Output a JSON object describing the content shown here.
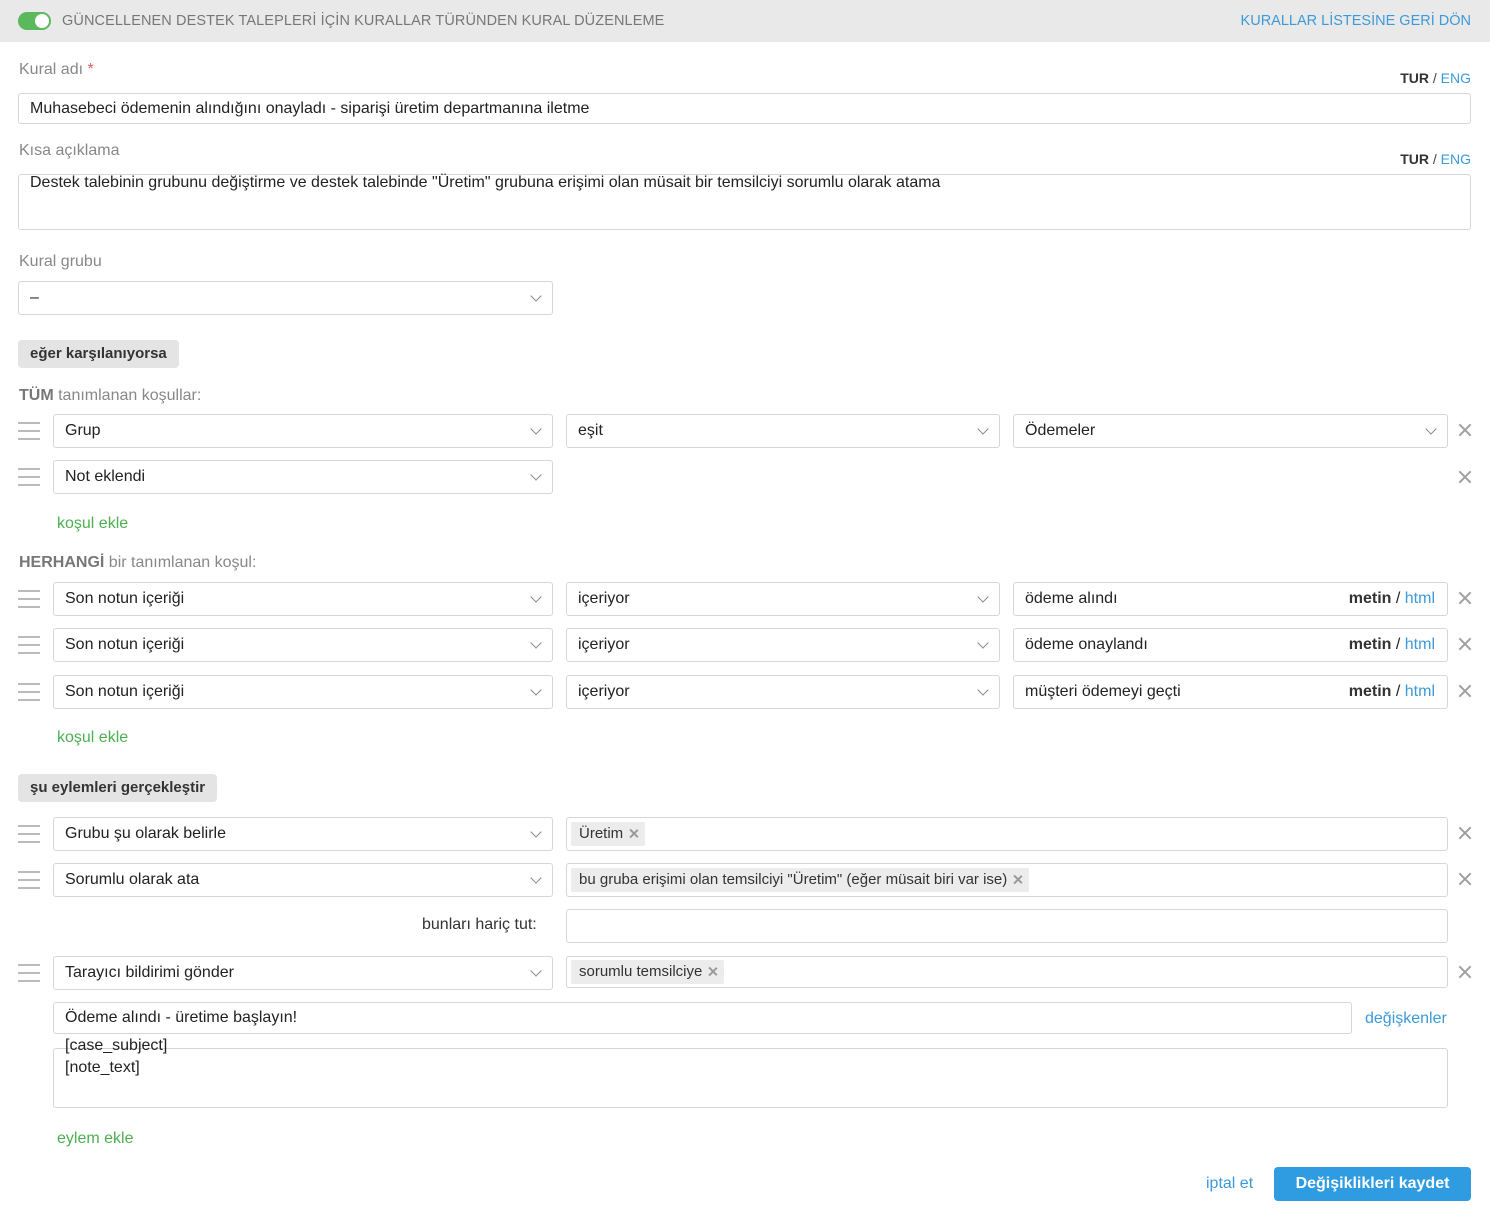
{
  "header": {
    "title": "GÜNCELLENEN DESTEK TALEPLERİ İÇİN KURALLAR TÜRÜNDEN KURAL DÜZENLEME",
    "back_link": "KURALLAR LİSTESİNE GERİ DÖN",
    "toggle_on": true
  },
  "language": {
    "current": "TUR",
    "separator": "/",
    "alternate": "ENG"
  },
  "rule_name": {
    "label": "Kural adı",
    "required_mark": "*",
    "value": "Muhasebeci ödemenin alındığını onayladı - siparişi üretim departmanına iletme"
  },
  "short_description": {
    "label": "Kısa açıklama",
    "value": "Destek talebinin grubunu değiştirme ve destek talebinde \"Üretim\" grubuna erişimi olan müsait bir temsilciyi sorumlu olarak atama"
  },
  "rule_group": {
    "label": "Kural grubu",
    "value": "–"
  },
  "conditions": {
    "section_label": "eğer karşılanıyorsa",
    "all": {
      "label_bold": "TÜM",
      "label_rest": " tanımlanan koşullar:",
      "rows": [
        {
          "field": "Grup",
          "operator": "eşit",
          "value": "Ödemeler"
        },
        {
          "field": "Not eklendi"
        }
      ],
      "add_label": "koşul ekle"
    },
    "any": {
      "label_bold": "HERHANGİ",
      "label_rest": " bir tanımlanan koşul:",
      "rows": [
        {
          "field": "Son notun içeriği",
          "operator": "içeriyor",
          "value": "ödeme alındı"
        },
        {
          "field": "Son notun içeriği",
          "operator": "içeriyor",
          "value": "ödeme onaylandı"
        },
        {
          "field": "Son notun içeriği",
          "operator": "içeriyor",
          "value": "müşteri ödemeyi geçti"
        }
      ],
      "add_label": "koşul ekle"
    },
    "format": {
      "current": "metin",
      "separator": "/",
      "alternate": "html"
    }
  },
  "actions": {
    "section_label": "şu eylemleri gerçekleştir",
    "rows": [
      {
        "action": "Grubu şu olarak belirle",
        "tags": [
          "Üretim"
        ]
      },
      {
        "action": "Sorumlu olarak ata",
        "tags": [
          "bu gruba erişimi olan temsilciyi \"Üretim\" (eğer müsait biri var ise)"
        ],
        "exclude_label": "bunları hariç tut:",
        "exclude_value": ""
      },
      {
        "action": "Tarayıcı bildirimi gönder",
        "tags": [
          "sorumlu temsilciye"
        ],
        "subject": "Ödeme alındı - üretime başlayın!",
        "variables_link": "değişkenler",
        "body_lines": [
          "[case_subject]",
          "[note_text]"
        ]
      }
    ],
    "add_label": "eylem ekle"
  },
  "footer": {
    "cancel_label": "iptal et",
    "save_label": "Değişiklikleri kaydet"
  },
  "colors": {
    "accent": "#3c9ad8",
    "toggle": "#5cb85c",
    "add_link": "#4caf50",
    "save_button": "#2f9be0",
    "required": "#e05c5c"
  },
  "icons": {
    "handle": "drag-handle-icon",
    "remove": "close-icon",
    "dropdown": "chevron-down-icon"
  }
}
